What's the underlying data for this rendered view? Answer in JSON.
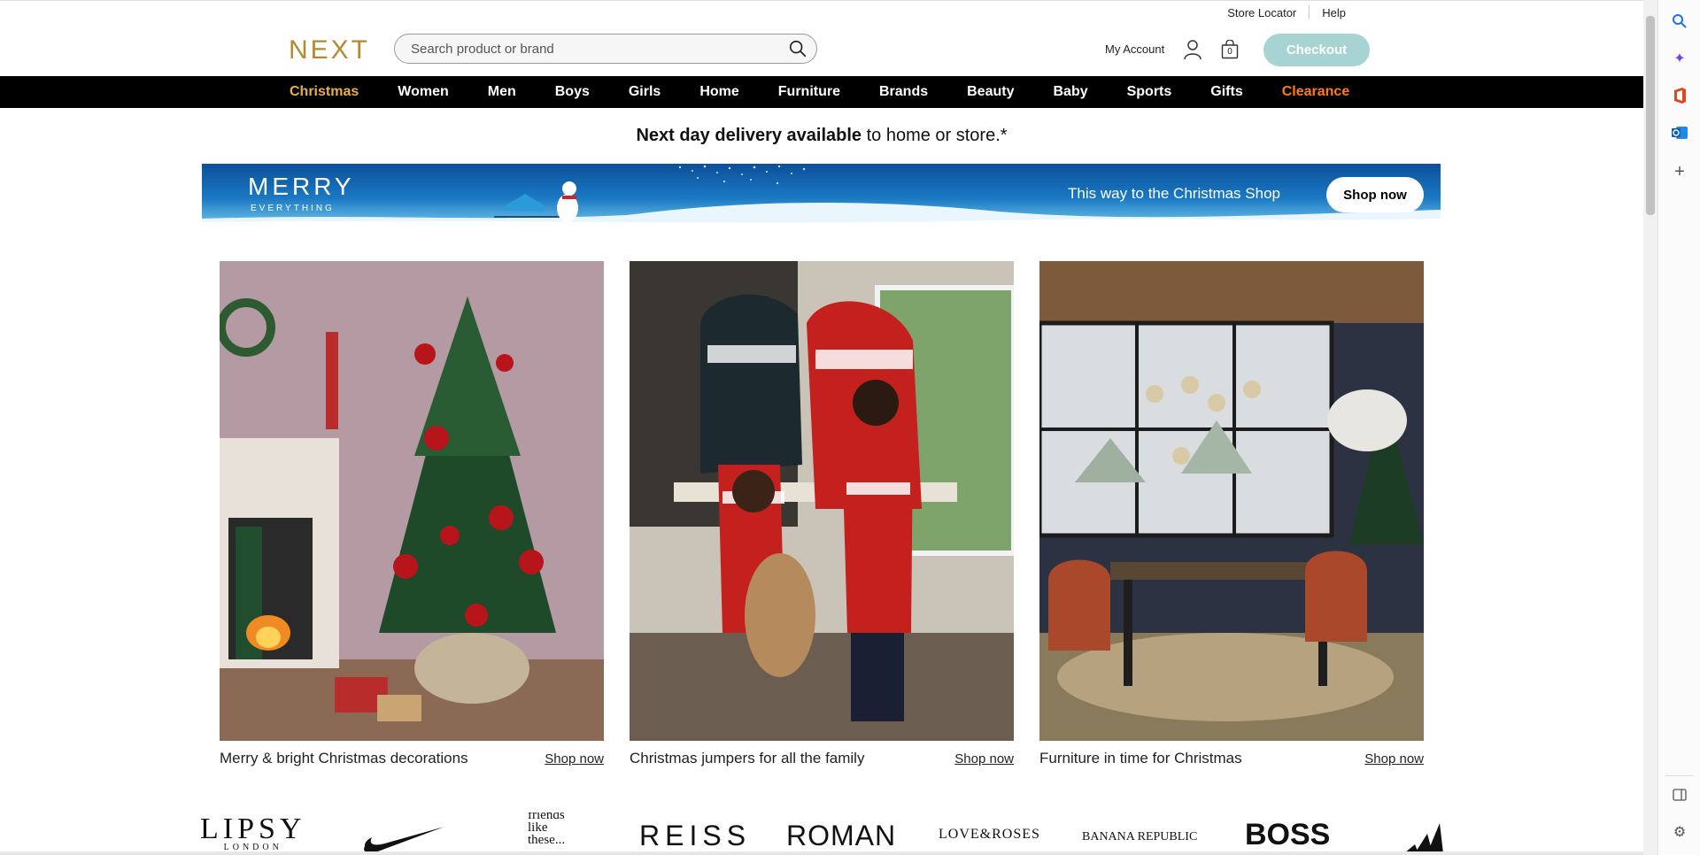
{
  "util": {
    "store_locator": "Store Locator",
    "help": "Help"
  },
  "header": {
    "logo": "NEXT",
    "search_placeholder": "Search product or brand",
    "my_account": "My Account",
    "bag_count": "0",
    "checkout": "Checkout"
  },
  "nav": {
    "items": [
      "Christmas",
      "Women",
      "Men",
      "Boys",
      "Girls",
      "Home",
      "Furniture",
      "Brands",
      "Beauty",
      "Baby",
      "Sports",
      "Gifts",
      "Clearance"
    ]
  },
  "delivery": {
    "bold": "Next day delivery available",
    "rest": " to home or store.*"
  },
  "banner": {
    "merry": "MERRY",
    "everything": "EVERYTHING",
    "tagline": "This way to the Christmas Shop",
    "button": "Shop now"
  },
  "tiles": [
    {
      "caption": "Merry & bright Christmas decorations",
      "link": "Shop now"
    },
    {
      "caption": "Christmas jumpers for all the family",
      "link": "Shop now"
    },
    {
      "caption": "Furniture in time for Christmas",
      "link": "Shop now"
    }
  ],
  "brands": {
    "lipsy": "LIPSY",
    "lipsy_sub": "LONDON",
    "friends1": "friends",
    "friends2": "like",
    "friends3": "these...",
    "reiss": "REISS",
    "roman": "ROMAN",
    "love_roses": "LOVE&ROSES",
    "banana": "BANANA REPUBLIC",
    "boss": "BOSS"
  },
  "colors": {
    "gold": "#b38a2e",
    "nav_gold": "#e7b04a",
    "clearance": "#ff7a1a",
    "checkout": "#a7d3d3"
  }
}
